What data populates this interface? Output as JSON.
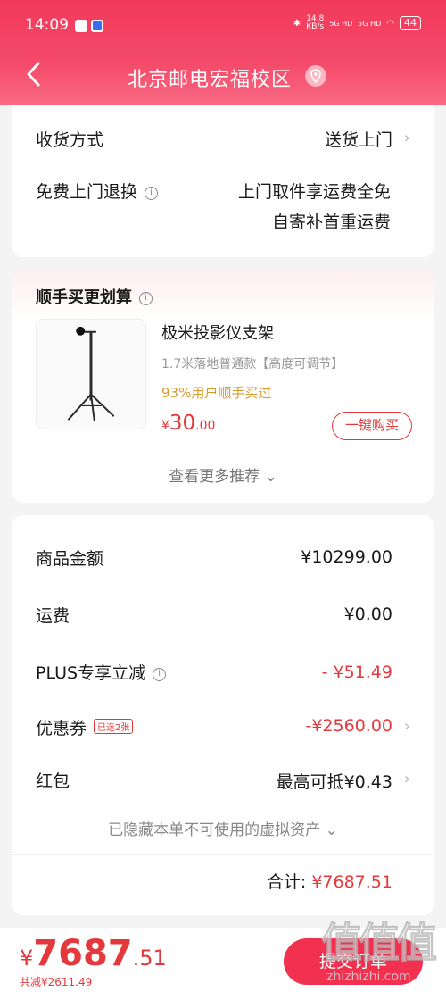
{
  "status_bar": {
    "time": "14:09",
    "speed_value": "14.8",
    "speed_unit": "KB/s",
    "network_1": "5G HD",
    "network_2": "5G HD",
    "battery": "44"
  },
  "header": {
    "title": "北京邮电宏福校区"
  },
  "delivery": {
    "method_label": "收货方式",
    "method_value": "送货上门",
    "return_label": "免费上门退换",
    "return_line1": "上门取件享运费全免",
    "return_line2": "自寄补首重运费"
  },
  "addon": {
    "section_title": "顺手买更划算",
    "product_name": "极米投影仪支架",
    "product_spec": "1.7米落地普通款【高度可调节】",
    "product_stat": "93%用户顺手买过",
    "price_symbol": "¥",
    "price_int": "30",
    "price_dec": ".00",
    "buy_label": "一键购买",
    "more_label": "查看更多推荐"
  },
  "summary": {
    "goods_label": "商品金额",
    "goods_value": "¥10299.00",
    "freight_label": "运费",
    "freight_value": "¥0.00",
    "plus_label": "PLUS专享立减",
    "plus_value": "- ¥51.49",
    "coupon_label": "优惠券",
    "coupon_tag": "已选2张",
    "coupon_value": "-¥2560.00",
    "redpacket_label": "红包",
    "redpacket_value": "最高可抵¥0.43",
    "hidden_assets": "已隐藏本单不可使用的虚拟资产",
    "total_label": "合计:",
    "total_value": "¥7687.51"
  },
  "bottom_bar": {
    "symbol": "¥",
    "int": "7687",
    "dec": ".51",
    "saved": "共减¥2611.49",
    "submit_label": "提交订单"
  },
  "watermark": {
    "big": "值值值",
    "small": "zhizhizhi.com"
  },
  "colors": {
    "accent": "#e4393c",
    "header": "#f2395b",
    "gold": "#d99a2b"
  }
}
